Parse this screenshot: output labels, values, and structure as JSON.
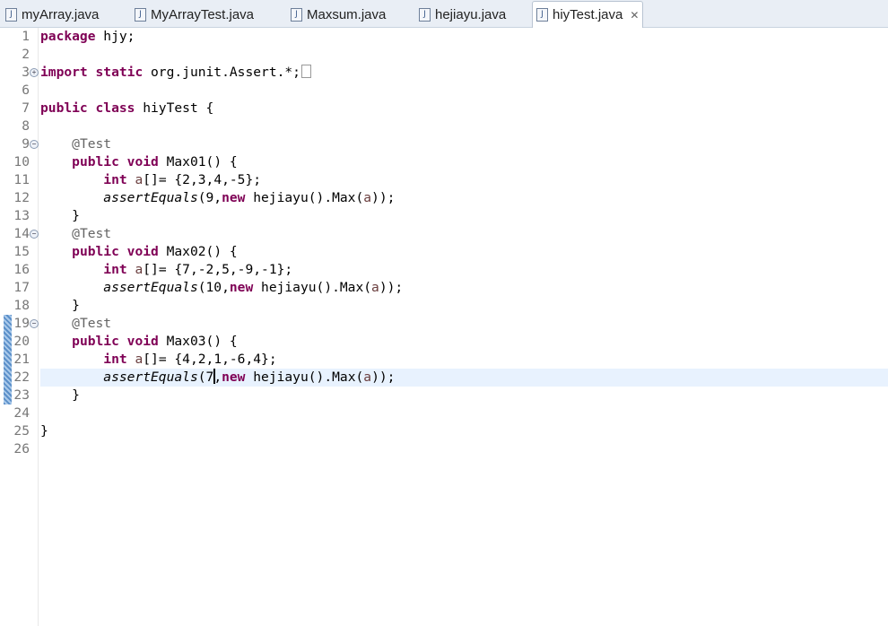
{
  "tabs": [
    {
      "label": "myArray.java",
      "active": false
    },
    {
      "label": "MyArrayTest.java",
      "active": false
    },
    {
      "label": "Maxsum.java",
      "active": false
    },
    {
      "label": "hejiayu.java",
      "active": false
    },
    {
      "label": "hiyTest.java",
      "active": true
    }
  ],
  "close_icon": "✕",
  "current_line": 22,
  "lines": [
    {
      "n": "1",
      "t": [
        [
          "package",
          "kw"
        ],
        [
          " hjy;",
          ""
        ]
      ]
    },
    {
      "n": "2",
      "t": []
    },
    {
      "n": "3",
      "fold": "+",
      "t": [
        [
          "import",
          "kw"
        ],
        [
          " ",
          ""
        ],
        [
          "static",
          "kw"
        ],
        [
          " org.junit.Assert.*;",
          ""
        ]
      ],
      "folded": true
    },
    {
      "n": "6",
      "t": []
    },
    {
      "n": "7",
      "t": [
        [
          "public",
          "kw"
        ],
        [
          " ",
          ""
        ],
        [
          "class",
          "kw"
        ],
        [
          " hiyTest {",
          ""
        ]
      ]
    },
    {
      "n": "8",
      "t": []
    },
    {
      "n": "9",
      "fold": "-",
      "t": [
        [
          "    ",
          ""
        ],
        [
          "@Test",
          "an"
        ]
      ]
    },
    {
      "n": "10",
      "t": [
        [
          "    ",
          ""
        ],
        [
          "public",
          "kw"
        ],
        [
          " ",
          ""
        ],
        [
          "void",
          "kw"
        ],
        [
          " Max01() {",
          ""
        ]
      ]
    },
    {
      "n": "11",
      "t": [
        [
          "        ",
          ""
        ],
        [
          "int",
          "kw"
        ],
        [
          " ",
          ""
        ],
        [
          "a",
          "var"
        ],
        [
          "[]= {2,3,4,-5};",
          ""
        ]
      ]
    },
    {
      "n": "12",
      "t": [
        [
          "        ",
          ""
        ],
        [
          "assertEquals",
          "it"
        ],
        [
          "(9,",
          ""
        ],
        [
          "new",
          "kw"
        ],
        [
          " hejiayu().Max(",
          ""
        ],
        [
          "a",
          "var"
        ],
        [
          "));",
          ""
        ]
      ]
    },
    {
      "n": "13",
      "t": [
        [
          "    }",
          ""
        ]
      ]
    },
    {
      "n": "14",
      "fold": "-",
      "t": [
        [
          "    ",
          ""
        ],
        [
          "@Test",
          "an"
        ]
      ]
    },
    {
      "n": "15",
      "t": [
        [
          "    ",
          ""
        ],
        [
          "public",
          "kw"
        ],
        [
          " ",
          ""
        ],
        [
          "void",
          "kw"
        ],
        [
          " Max02() {",
          ""
        ]
      ]
    },
    {
      "n": "16",
      "t": [
        [
          "        ",
          ""
        ],
        [
          "int",
          "kw"
        ],
        [
          " ",
          ""
        ],
        [
          "a",
          "var"
        ],
        [
          "[]= {7,-2,5,-9,-1};",
          ""
        ]
      ]
    },
    {
      "n": "17",
      "t": [
        [
          "        ",
          ""
        ],
        [
          "assertEquals",
          "it"
        ],
        [
          "(10,",
          ""
        ],
        [
          "new",
          "kw"
        ],
        [
          " hejiayu().Max(",
          ""
        ],
        [
          "a",
          "var"
        ],
        [
          "));",
          ""
        ]
      ]
    },
    {
      "n": "18",
      "t": [
        [
          "    }",
          ""
        ]
      ]
    },
    {
      "n": "19",
      "fold": "-",
      "t": [
        [
          "    ",
          ""
        ],
        [
          "@Test",
          "an"
        ]
      ]
    },
    {
      "n": "20",
      "t": [
        [
          "    ",
          ""
        ],
        [
          "public",
          "kw"
        ],
        [
          " ",
          ""
        ],
        [
          "void",
          "kw"
        ],
        [
          " Max03() {",
          ""
        ]
      ]
    },
    {
      "n": "21",
      "t": [
        [
          "        ",
          ""
        ],
        [
          "int",
          "kw"
        ],
        [
          " ",
          ""
        ],
        [
          "a",
          "var"
        ],
        [
          "[]= {4,2,1,-6,4};",
          ""
        ]
      ]
    },
    {
      "n": "22",
      "t": [
        [
          "        ",
          ""
        ],
        [
          "assertEquals",
          "it"
        ],
        [
          "(7",
          ""
        ],
        [
          "|",
          "caret"
        ],
        [
          ",",
          ""
        ],
        [
          "new",
          "kw"
        ],
        [
          " hejiayu().Max(",
          ""
        ],
        [
          "a",
          "var"
        ],
        [
          "));",
          ""
        ]
      ]
    },
    {
      "n": "23",
      "t": [
        [
          "    }",
          ""
        ]
      ]
    },
    {
      "n": "24",
      "t": []
    },
    {
      "n": "25",
      "t": [
        [
          "}",
          ""
        ]
      ]
    },
    {
      "n": "26",
      "t": []
    }
  ]
}
